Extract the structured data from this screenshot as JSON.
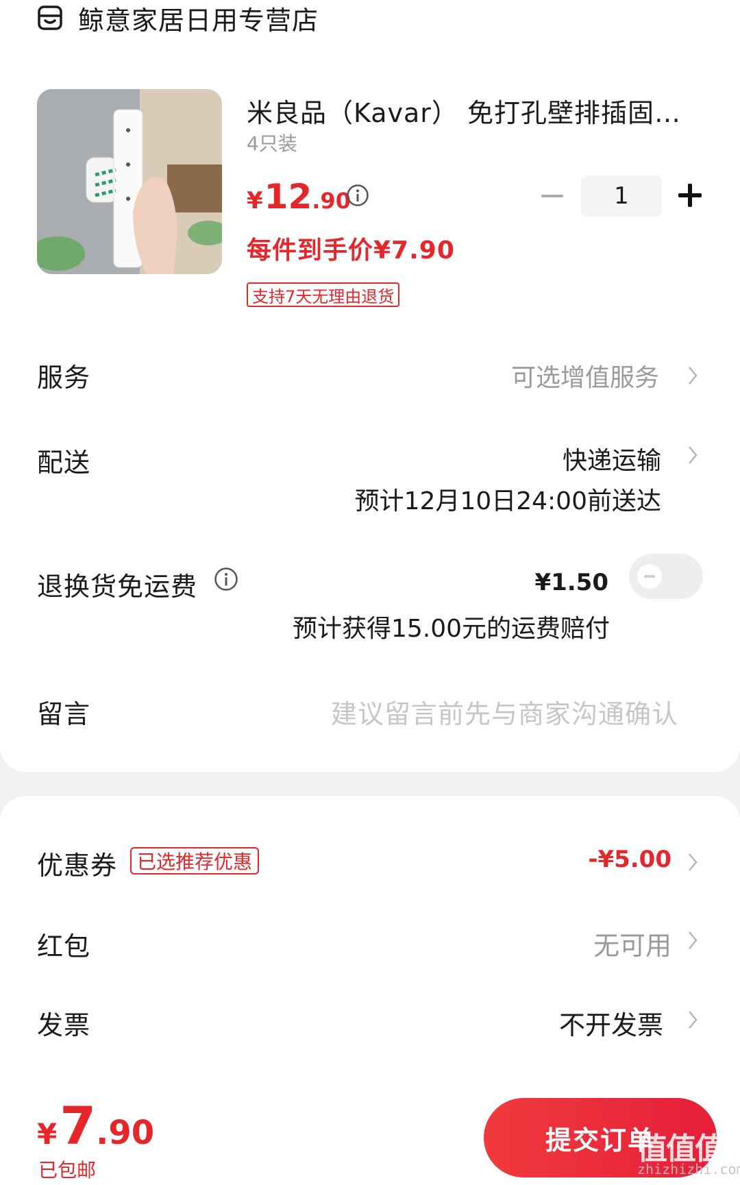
{
  "shop": {
    "name": "鲸意家居日用专营店",
    "icon": "store-icon"
  },
  "product": {
    "title": "米良品（Kavar） 免打孔壁排插固定…",
    "spec": "4只装",
    "price_symbol": "¥",
    "price_int": "12",
    "price_dec": ".90",
    "quantity": "1",
    "each_price": "每件到手价¥7.90",
    "return_tag": "支持7天无理由退货"
  },
  "rows": {
    "service": {
      "label": "服务",
      "value": "可选增值服务"
    },
    "delivery": {
      "label": "配送",
      "value": "快递运输",
      "eta": "预计12月10日24:00前送达"
    },
    "return_shipping": {
      "label": "退换货免运费",
      "price": "¥1.50",
      "compensation": "预计获得15.00元的运费赔付",
      "enabled": false
    },
    "message": {
      "label": "留言",
      "placeholder": "建议留言前先与商家沟通确认"
    }
  },
  "discounts": {
    "coupon": {
      "label": "优惠券",
      "tag": "已选推荐优惠",
      "value": "-¥5.00"
    },
    "red_packet": {
      "label": "红包",
      "value": "无可用"
    },
    "invoice": {
      "label": "发票",
      "value": "不开发票"
    }
  },
  "footer": {
    "total_symbol": "¥",
    "total_int": "7",
    "total_dec": ".90",
    "shipping_note": "已包邮",
    "submit_label": "提交订单"
  },
  "watermark": {
    "glyphs": "值值值",
    "url": "zhizhizhi.com"
  },
  "colors": {
    "accent": "#e5262a",
    "background": "#f2f2f2",
    "card": "#ffffff"
  }
}
